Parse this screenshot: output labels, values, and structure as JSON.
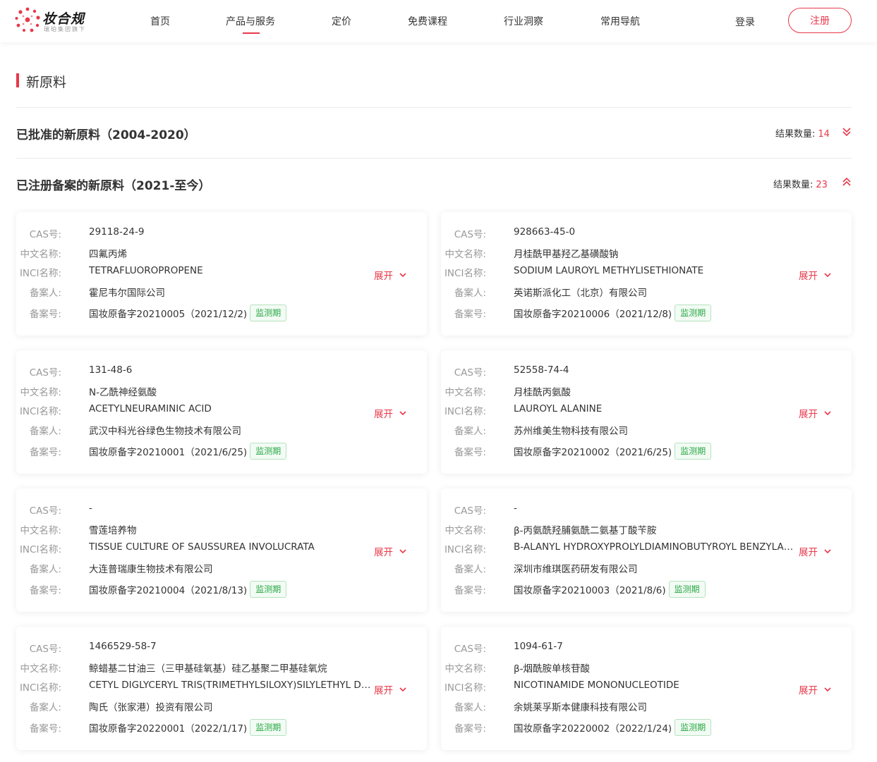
{
  "header": {
    "logo_title": "妆合规",
    "logo_subtitle": "瑞珀集团旗下",
    "nav": [
      {
        "label": "首页",
        "active": false
      },
      {
        "label": "产品与服务",
        "active": true
      },
      {
        "label": "定价",
        "active": false
      },
      {
        "label": "免费课程",
        "active": false
      },
      {
        "label": "行业洞察",
        "active": false
      },
      {
        "label": "常用导航",
        "active": false
      }
    ],
    "login": "登录",
    "register": "注册"
  },
  "colors": {
    "accent": "#e8384a",
    "badge_green": "#29a844"
  },
  "page": {
    "title": "新原料"
  },
  "sections": [
    {
      "title": "已批准的新原料（2004-2020）",
      "count_label": "结果数量:",
      "count": "14",
      "toggle_icon": "chevron-double-down-icon"
    },
    {
      "title": "已注册备案的新原料（2021-至今）",
      "count_label": "结果数量:",
      "count": "23",
      "toggle_icon": "chevron-double-up-icon"
    }
  ],
  "field_labels": {
    "cas": "CAS号:",
    "cn_name": "中文名称:",
    "inci": "INCI名称:",
    "filer": "备案人:",
    "record_no": "备案号:"
  },
  "expand_label": "展开",
  "cards": [
    {
      "cas": "29118-24-9",
      "cn_name": "四氟丙烯",
      "inci": "TETRAFLUOROPROPENE",
      "filer": "霍尼韦尔国际公司",
      "record_no": "国妆原备字20210005（2021/12/2)",
      "badge": "监测期"
    },
    {
      "cas": "928663-45-0",
      "cn_name": "月桂酰甲基羟乙基磺酸钠",
      "inci": "SODIUM LAUROYL METHYLISETHIONATE",
      "filer": "英诺斯派化工（北京）有限公司",
      "record_no": "国妆原备字20210006（2021/12/8)",
      "badge": "监测期"
    },
    {
      "cas": "131-48-6",
      "cn_name": "N-乙酰神经氨酸",
      "inci": "ACETYLNEURAMINIC ACID",
      "filer": "武汉中科光谷绿色生物技术有限公司",
      "record_no": "国妆原备字20210001（2021/6/25)",
      "badge": "监测期"
    },
    {
      "cas": "52558-74-4",
      "cn_name": "月桂酰丙氨酸",
      "inci": "LAUROYL ALANINE",
      "filer": "苏州维美生物科技有限公司",
      "record_no": "国妆原备字20210002（2021/6/25)",
      "badge": "监测期"
    },
    {
      "cas": "-",
      "cn_name": "雪莲培养物",
      "inci": "TISSUE CULTURE OF SAUSSUREA INVOLUCRATA",
      "filer": "大连普瑞康生物技术有限公司",
      "record_no": "国妆原备字20210004（2021/8/13)",
      "badge": "监测期"
    },
    {
      "cas": "-",
      "cn_name": "β-丙氨酰羟脯氨酰二氨基丁酸苄胺",
      "inci": "B-ALANYL HYDROXYPROLYLDIAMINOBUTYROYL BENZYLAMIDE",
      "filer": "深圳市维琪医药研发有限公司",
      "record_no": "国妆原备字20210003（2021/8/6)",
      "badge": "监测期"
    },
    {
      "cas": "1466529-58-7",
      "cn_name": "鲸蜡基二甘油三（三甲基硅氧基）硅乙基聚二甲基硅氧烷",
      "inci": "CETYL DIGLYCERYL TRIS(TRIMETHYLSILOXY)SILYLETHYL DIMETHICONE",
      "filer": "陶氏（张家港）投资有限公司",
      "record_no": "国妆原备字20220001（2022/1/17)",
      "badge": "监测期"
    },
    {
      "cas": "1094-61-7",
      "cn_name": "β-烟酰胺单核苷酸",
      "inci": "NICOTINAMIDE MONONUCLEOTIDE",
      "filer": "余姚莱孚斯本健康科技有限公司",
      "record_no": "国妆原备字20220002（2022/1/24)",
      "badge": "监测期"
    }
  ]
}
